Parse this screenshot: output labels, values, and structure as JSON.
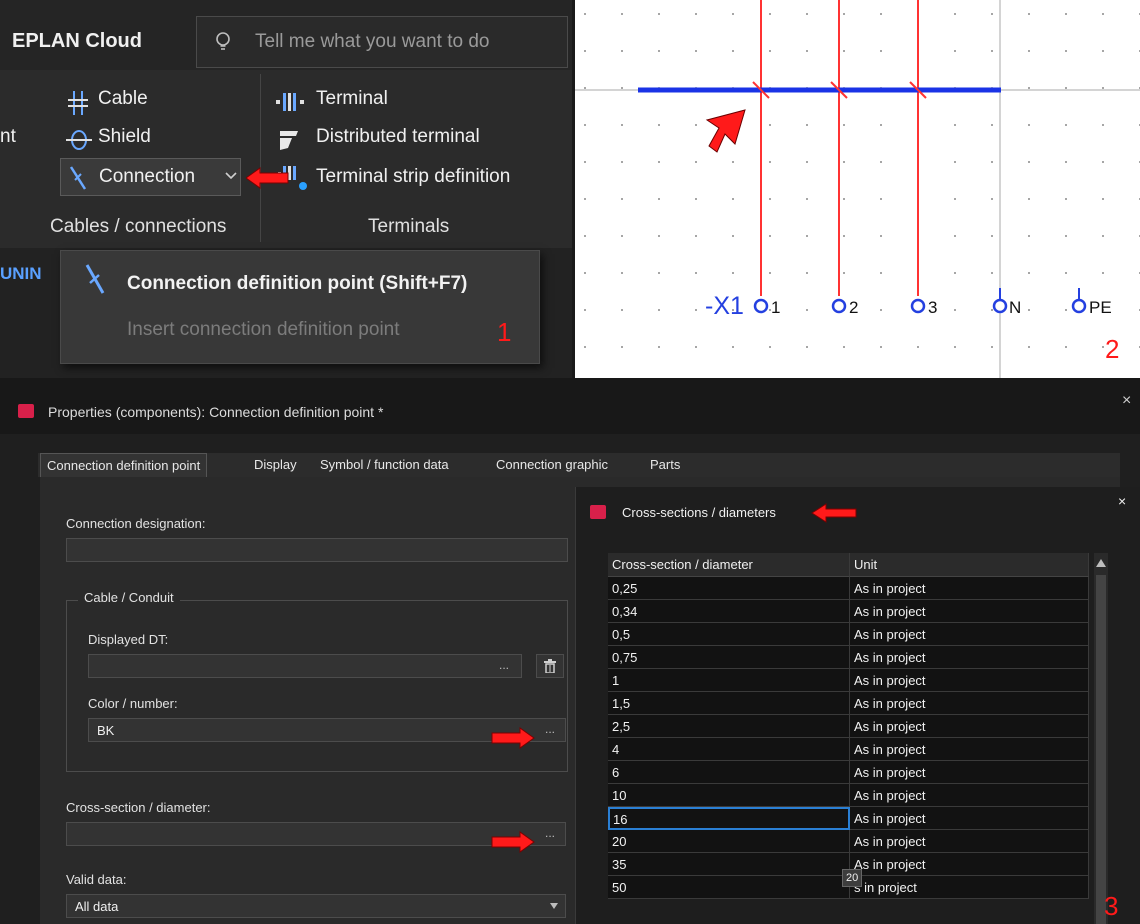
{
  "ribbon": {
    "app_label": "EPLAN Cloud",
    "search_placeholder": "Tell me what you want to do",
    "partial_left_text": "nt",
    "cable_group": {
      "items": [
        "Cable",
        "Shield",
        "Connection"
      ],
      "label": "Cables / connections"
    },
    "terminal_group": {
      "items": [
        "Terminal",
        "Distributed terminal",
        "Terminal strip definition"
      ],
      "label": "Terminals"
    },
    "partial_tab_text": "UNIN"
  },
  "dropdown": {
    "main_item": "Connection definition point (Shift+F7)",
    "sub_item": "Insert connection definition point",
    "marker": "1"
  },
  "schematic": {
    "device_tag": "-X1",
    "terminals": [
      "1",
      "2",
      "3",
      "N",
      "PE"
    ],
    "marker": "2",
    "colors": {
      "connection_line": "#1a33e6",
      "wire": "#ff3333",
      "terminal": "#2440e0"
    }
  },
  "dialog": {
    "title": "Properties (components): Connection definition point *",
    "tabs": [
      "Connection definition point",
      "Display",
      "Symbol / function data",
      "Connection graphic",
      "Parts"
    ],
    "connection_designation": {
      "label": "Connection designation:",
      "value": ""
    },
    "cable_group_title": "Cable / Conduit",
    "displayed_dt": {
      "label": "Displayed DT:",
      "value": "",
      "button": "..."
    },
    "color_number": {
      "label": "Color / number:",
      "value": "BK",
      "button": "..."
    },
    "cross_section": {
      "label": "Cross-section / diameter:",
      "value": "",
      "button": "..."
    },
    "valid_data": {
      "label": "Valid data:",
      "value": "All data"
    }
  },
  "popup": {
    "title": "Cross-sections / diameters",
    "columns": [
      "Cross-section / diameter",
      "Unit"
    ],
    "rows": [
      [
        "0,25",
        "As in project"
      ],
      [
        "0,34",
        "As in project"
      ],
      [
        "0,5",
        "As in project"
      ],
      [
        "0,75",
        "As in project"
      ],
      [
        "1",
        "As in project"
      ],
      [
        "1,5",
        "As in project"
      ],
      [
        "2,5",
        "As in project"
      ],
      [
        "4",
        "As in project"
      ],
      [
        "6",
        "As in project"
      ],
      [
        "10",
        "As in project"
      ],
      [
        "16",
        "As in project"
      ],
      [
        "20",
        "As in project"
      ],
      [
        "35",
        "As in project"
      ],
      [
        "50",
        "s in project"
      ]
    ],
    "selected_value": "16",
    "tooltip": "20",
    "marker": "3"
  }
}
